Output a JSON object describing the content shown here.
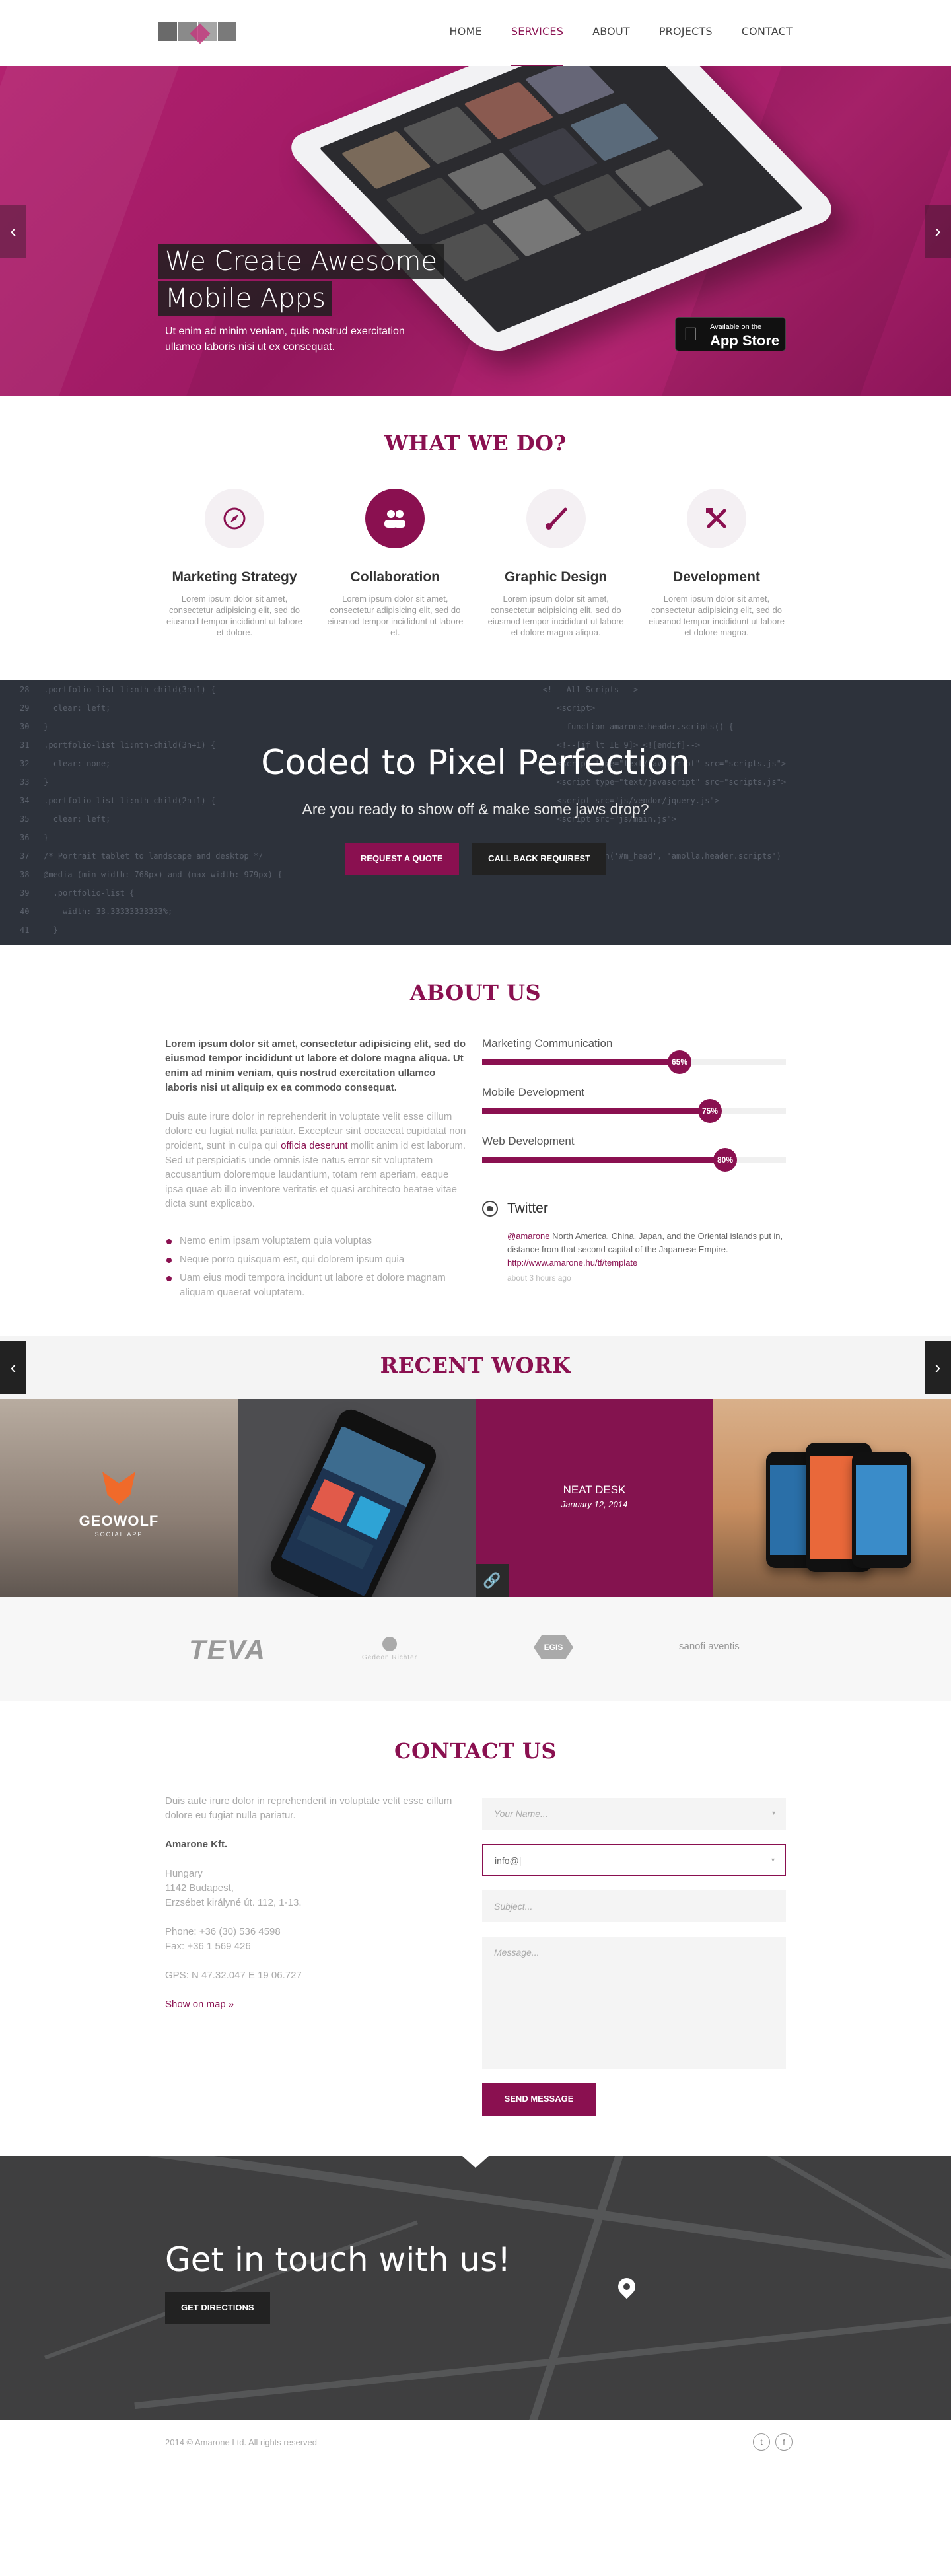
{
  "nav": {
    "items": [
      "HOME",
      "SERVICES",
      "ABOUT",
      "PROJECTS",
      "CONTACT"
    ],
    "active": "SERVICES"
  },
  "hero": {
    "title_line1": "We Create Awesome",
    "title_line2": "Mobile Apps",
    "subtitle": "Ut enim ad minim veniam, quis nostrud exercitation ullamco laboris nisi ut ex consequat.",
    "appstore_small": "Available on the",
    "appstore_big": "App Store",
    "prev": "‹",
    "next": "›"
  },
  "what_we_do": {
    "title": "WHAT WE DO?",
    "items": [
      {
        "name": "Marketing Strategy",
        "text": "Lorem ipsum dolor sit amet, consectetur adipisicing elit, sed do eiusmod tempor incididunt ut labore et dolore.",
        "icon": "compass-icon"
      },
      {
        "name": "Collaboration",
        "text": "Lorem ipsum dolor sit amet, consectetur adipisicing elit, sed do eiusmod tempor incididunt ut labore et.",
        "icon": "users-icon"
      },
      {
        "name": "Graphic Design",
        "text": "Lorem ipsum dolor sit amet, consectetur adipisicing elit, sed do eiusmod tempor incididunt ut labore et dolore magna aliqua.",
        "icon": "brush-icon"
      },
      {
        "name": "Development",
        "text": "Lorem ipsum dolor sit amet, consectetur adipisicing elit, sed do eiusmod tempor incididunt ut labore et dolore magna.",
        "icon": "tools-icon"
      }
    ]
  },
  "coded": {
    "title": "Coded to Pixel Perfection",
    "subtitle": "Are you ready to show off & make some jaws drop?",
    "quote_btn": "REQUEST A QUOTE",
    "callback_btn": "CALL BACK REQUIREST"
  },
  "about": {
    "title": "ABOUT US",
    "lead": "Lorem ipsum dolor sit amet, consectetur adipisicing elit, sed do eiusmod tempor incididunt ut labore et dolore magna aliqua. Ut enim ad minim veniam, quis nostrud exercitation ullamco laboris nisi ut aliquip ex ea commodo consequat.",
    "para_a": "Duis aute irure dolor in reprehenderit in voluptate velit esse cillum dolore eu fugiat nulla pariatur. Excepteur sint occaecat cupidatat non proident, sunt in culpa qui ",
    "para_em": "officia deserunt",
    "para_b": " mollit anim id est laborum. Sed ut perspiciatis unde omnis iste natus error sit voluptatem accusantium doloremque laudantium, totam rem aperiam, eaque ipsa quae ab illo inventore veritatis et quasi architecto beatae vitae dicta sunt explicabo.",
    "bullets": [
      "Nemo enim ipsam voluptatem quia voluptas",
      "Neque porro quisquam est, qui dolorem ipsum quia",
      "Uam eius modi tempora incidunt ut labore et dolore magnam aliquam quaerat voluptatem."
    ],
    "skills": [
      {
        "label": "Marketing Communication",
        "value": 65,
        "text": "65%"
      },
      {
        "label": "Mobile Development",
        "value": 75,
        "text": "75%"
      },
      {
        "label": "Web Development",
        "value": 80,
        "text": "80%"
      }
    ],
    "twitter": {
      "title": "Twitter",
      "handle": "@amarone",
      "text": " North America, China, Japan, and the Oriental islands put in, distance from that second capital of the Japanese Empire. ",
      "link": "http://www.amarone.hu/tf/template",
      "time": "about 3 hours ago"
    }
  },
  "recent_work": {
    "title": "RECENT WORK",
    "w1_title": "GEOWOLF",
    "w1_sub": "SOCIAL APP",
    "w3_title": "NEAT DESK",
    "w3_date": "January 12, 2014",
    "link_icon": "🔗",
    "prev": "‹",
    "next": "›"
  },
  "clients": {
    "teva": "TEVA",
    "ri": "Gedeon Richter",
    "egis": "EGIS",
    "sanofi": "sanofi aventis"
  },
  "contact": {
    "title": "CONTACT US",
    "intro": "Duis aute irure dolor in reprehenderit in voluptate velit esse cillum dolore eu fugiat nulla pariatur.",
    "company": "Amarone Kft.",
    "address1": "Hungary",
    "address2": "1142 Budapest,",
    "address3": "Erzsébet királyné út. 112, 1-13.",
    "phone": "Phone: +36 (30) 536 4598",
    "fax": "Fax: +36 1 569 426",
    "gps": "GPS: N 47.32.047 E 19 06.727",
    "map_link": "Show on map »",
    "name_placeholder": "Your Name...",
    "email_value": "info@|",
    "subject_placeholder": "Subject...",
    "message_placeholder": "Message...",
    "send_btn": "SEND MESSAGE"
  },
  "map": {
    "title": "Get in touch with us!",
    "directions_btn": "GET DIRECTIONS"
  },
  "footer": {
    "copy": "2014 © Amarone Ltd. All rights reserved",
    "twitter": "t",
    "facebook": "f"
  },
  "colors": {
    "accent": "#8a1050",
    "hero": "#a41d68",
    "dark": "#2d323b"
  }
}
